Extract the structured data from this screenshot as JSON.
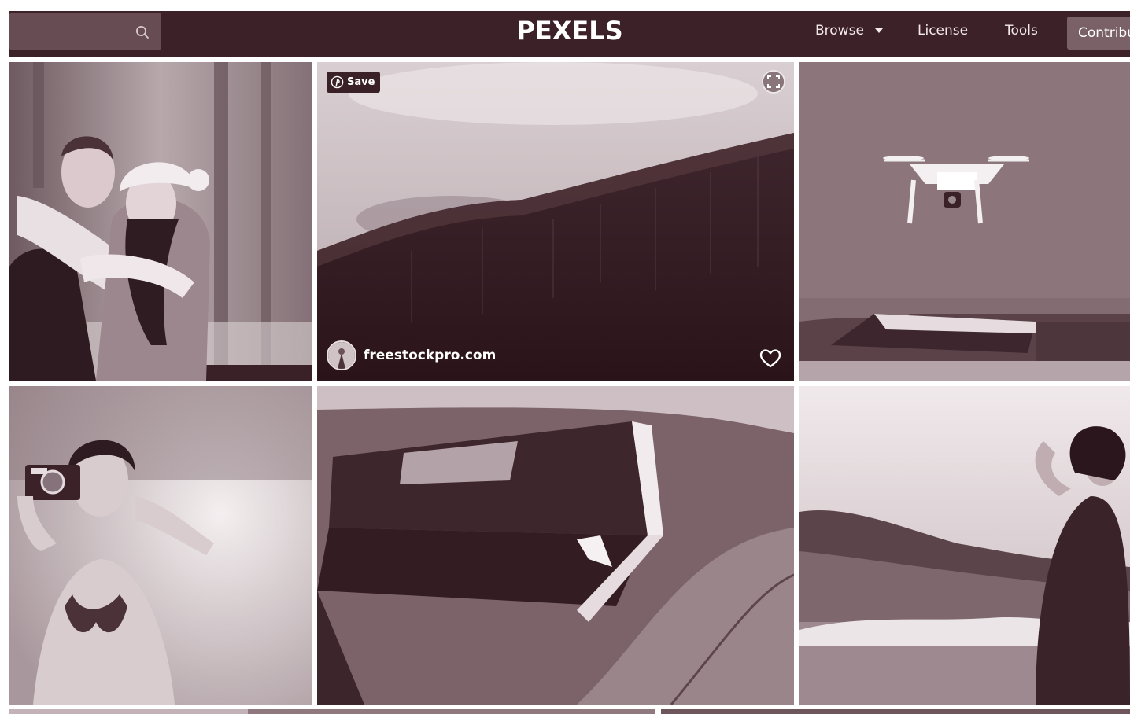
{
  "header": {
    "logo": "PEXELS",
    "search": {
      "value": "",
      "placeholder": "",
      "icon": "search-icon"
    },
    "nav": {
      "browse": "Browse",
      "license": "License",
      "tools": "Tools",
      "contribute": "Contribute"
    }
  },
  "featured_photo": {
    "save_label": "Save",
    "author": "freestockpro.com",
    "icons": [
      "pinterest-icon",
      "expand-icon",
      "heart-icon",
      "avatar"
    ]
  },
  "theme": {
    "header_bg": "#3c2129",
    "search_bg": "#684c54",
    "contribute_bg": "#7a6168",
    "tint": "#3c2129"
  }
}
